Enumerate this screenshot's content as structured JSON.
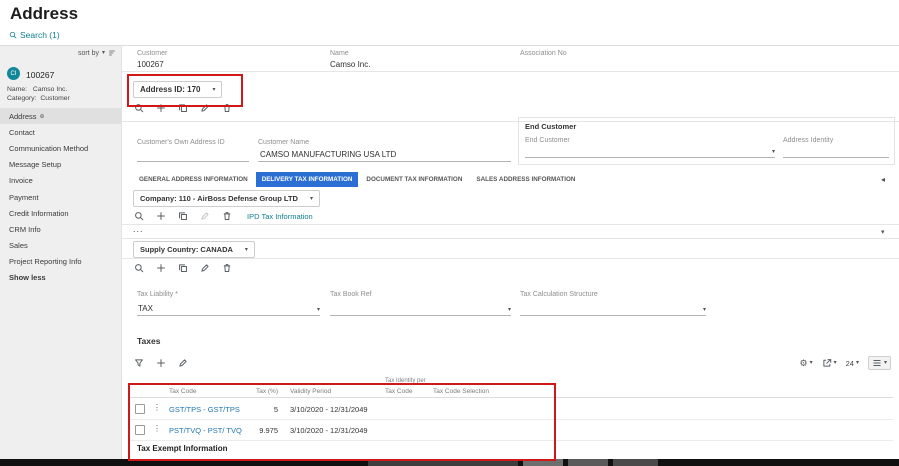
{
  "colors": {
    "accent_teal": "#0d7f8e",
    "active_tab_blue": "#2b6fd4",
    "annotation_red": "#d01818",
    "avatar_teal": "#11889a",
    "link_blue": "#1f74ad"
  },
  "icons": {
    "caret_down": "▾",
    "kebab": "⋮",
    "gear": "⚙",
    "back_arrow": "◂",
    "address_badge": "⊕"
  },
  "page": {
    "title": "Address",
    "search_label": "Search (1)"
  },
  "sidebar": {
    "sort_by": "sort by",
    "avatar_initials": "CI",
    "record_id": "100267",
    "name_label": "Name:",
    "name_value": "Camso Inc.",
    "category_label": "Category:",
    "category_value": "Customer",
    "items": [
      {
        "label": "Address"
      },
      {
        "label": "Contact"
      },
      {
        "label": "Communication Method"
      },
      {
        "label": "Message Setup"
      },
      {
        "label": "Invoice"
      },
      {
        "label": "Payment"
      },
      {
        "label": "Credit Information"
      },
      {
        "label": "CRM Info"
      },
      {
        "label": "Sales"
      },
      {
        "label": "Project Reporting Info"
      },
      {
        "label": "Show less"
      }
    ]
  },
  "header": {
    "customer_label": "Customer",
    "customer_value": "100267",
    "name_label": "Name",
    "name_value": "Camso Inc.",
    "association_label": "Association No"
  },
  "address": {
    "address_id_label": "Address ID: 170",
    "own_address_id_label": "Customer's Own Address ID",
    "customer_name_label": "Customer Name",
    "customer_name_value": "CAMSO MANUFACTURING USA LTD",
    "end_customer": {
      "title": "End Customer",
      "end_customer_label": "End Customer",
      "address_identity_label": "Address Identity"
    }
  },
  "tabs": [
    {
      "label": "GENERAL ADDRESS INFORMATION"
    },
    {
      "label": "DELIVERY TAX INFORMATION"
    },
    {
      "label": "DOCUMENT TAX INFORMATION"
    },
    {
      "label": "SALES ADDRESS INFORMATION"
    }
  ],
  "delivery_tax": {
    "company_label": "Company: 110 - AirBoss Defense Group LTD",
    "ipd_link": "IPD Tax Information",
    "more_label": "...",
    "supply_country_label": "Supply Country: CANADA",
    "fields": [
      {
        "label": "Tax Liability *",
        "value": "TAX"
      },
      {
        "label": "Tax Book Ref",
        "value": ""
      },
      {
        "label": "Tax Calculation Structure",
        "value": ""
      }
    ],
    "taxes": {
      "title": "Taxes",
      "page_size": "24",
      "group_header": "Tax Identity per",
      "columns": [
        "Tax Code",
        "Tax (%)",
        "Validity Period",
        "Tax Code",
        "Tax Code Selection"
      ],
      "rows": [
        {
          "tax_code": "GST/TPS - GST/TPS",
          "tax_pct": "5",
          "validity": "3/10/2020 - 12/31/2049"
        },
        {
          "tax_code": "PST/TVQ - PST/ TVQ",
          "tax_pct": "9.975",
          "validity": "3/10/2020 - 12/31/2049"
        }
      ]
    },
    "tax_exempt_title": "Tax Exempt Information"
  }
}
